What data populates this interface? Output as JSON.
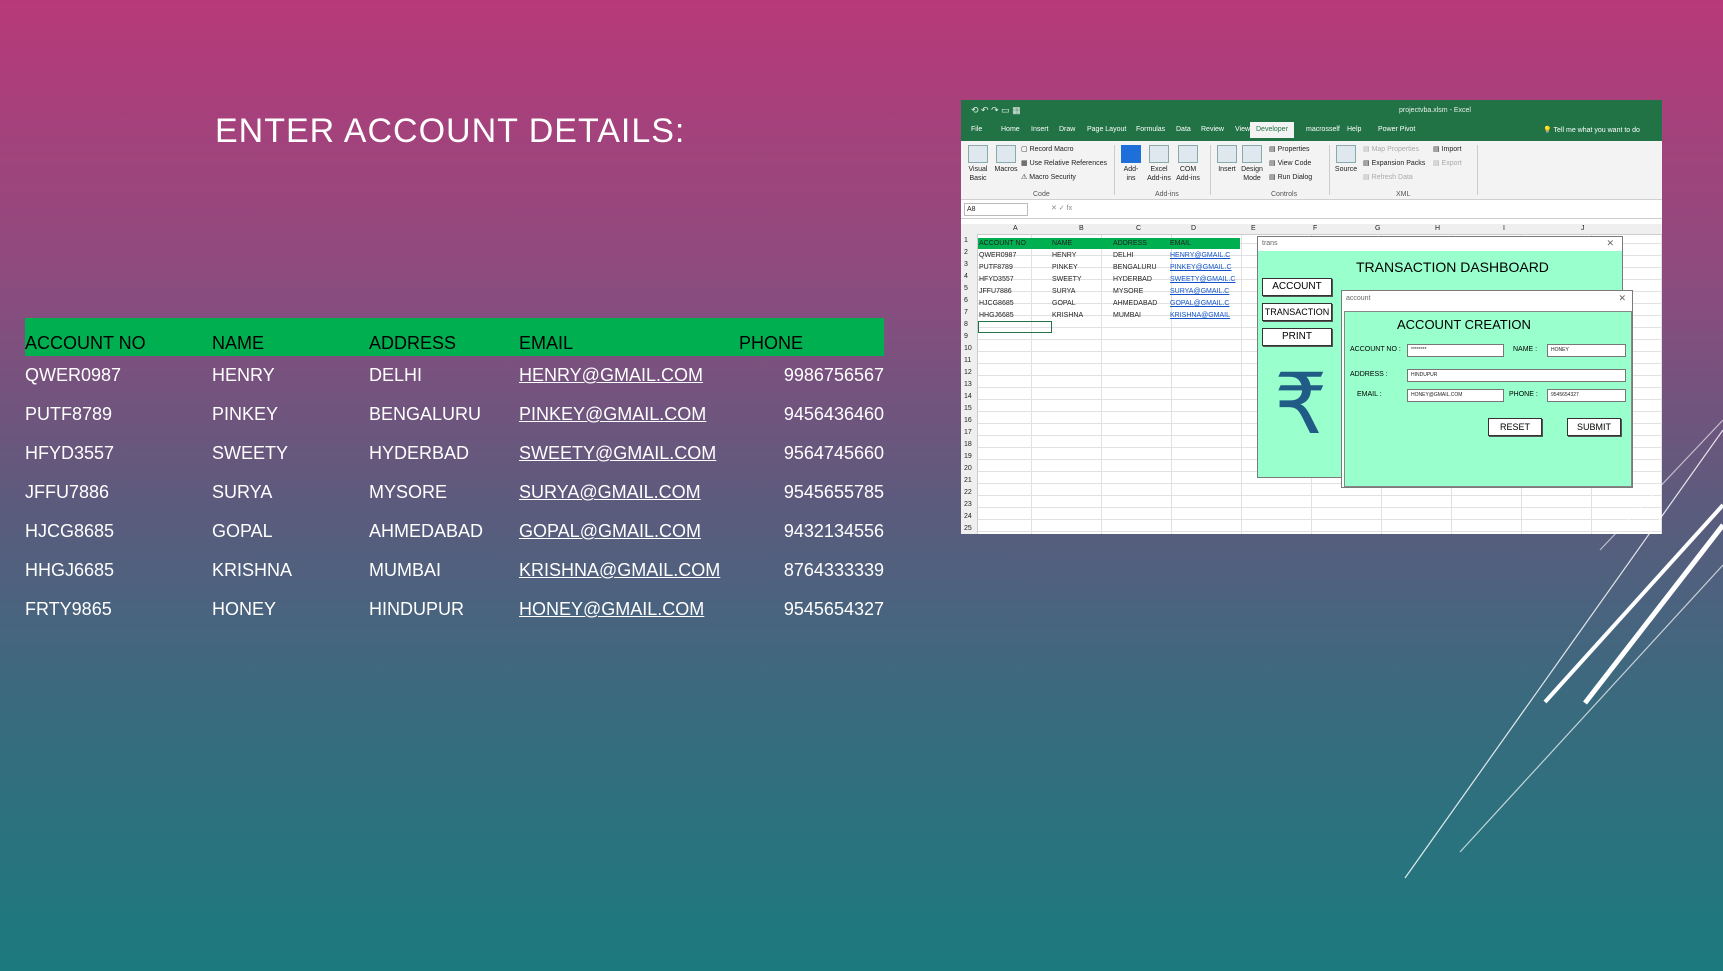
{
  "slide": {
    "title": "ENTER ACCOUNT DETAILS:"
  },
  "table": {
    "headers": [
      "ACCOUNT NO",
      "NAME",
      "ADDRESS",
      "EMAIL",
      "PHONE"
    ],
    "rows": [
      [
        "QWER0987",
        "HENRY",
        "DELHI",
        "HENRY@GMAIL.COM",
        "9986756567"
      ],
      [
        "PUTF8789",
        "PINKEY",
        "BENGALURU",
        "PINKEY@GMAIL.COM",
        "9456436460"
      ],
      [
        "HFYD3557",
        "SWEETY",
        "HYDERBAD",
        "SWEETY@GMAIL.COM",
        "9564745660"
      ],
      [
        "JFFU7886",
        "SURYA",
        "MYSORE",
        "SURYA@GMAIL.COM",
        "9545655785"
      ],
      [
        "HJCG8685",
        "GOPAL",
        "AHMEDABAD",
        "GOPAL@GMAIL.COM",
        "9432134556"
      ],
      [
        "HHGJ6685",
        "KRISHNA",
        "MUMBAI",
        "KRISHNA@GMAIL.COM",
        "8764333339"
      ],
      [
        "FRTY9865",
        "HONEY",
        "HINDUPUR",
        "HONEY@GMAIL.COM",
        "9545654327"
      ]
    ]
  },
  "excel": {
    "filename": "projectvba.xlsm  -  Excel",
    "tabs": [
      "File",
      "Home",
      "Insert",
      "Draw",
      "Page Layout",
      "Formulas",
      "Data",
      "Review",
      "View",
      "Developer",
      "macrosself",
      "Help",
      "Power Pivot"
    ],
    "active_tab": "Developer",
    "tell_me": "Tell me what you want to do",
    "ribbon": {
      "visual_basic": "Visual Basic",
      "macros": "Macros",
      "record_macro": "Record Macro",
      "use_relative": "Use Relative References",
      "macro_security": "Macro Security",
      "code_group": "Code",
      "addins": "Add-ins",
      "excel_addins": "Excel Add-ins",
      "com_addins": "COM Add-ins",
      "addins_group": "Add-ins",
      "insert": "Insert",
      "design_mode": "Design Mode",
      "properties": "Properties",
      "view_code": "View Code",
      "run_dialog": "Run Dialog",
      "controls_group": "Controls",
      "source": "Source",
      "map_properties": "Map Properties",
      "expansion_packs": "Expansion Packs",
      "refresh_data": "Refresh Data",
      "import": "Import",
      "export": "Export",
      "xml_group": "XML"
    },
    "name_box": "A8",
    "columns": [
      "A",
      "B",
      "C",
      "D",
      "E",
      "F",
      "G",
      "H",
      "I",
      "J"
    ],
    "row_numbers": [
      "1",
      "2",
      "3",
      "4",
      "5",
      "6",
      "7",
      "8",
      "9",
      "10",
      "11",
      "12",
      "13",
      "14",
      "15",
      "16",
      "17",
      "18",
      "19",
      "20",
      "21",
      "22",
      "23",
      "24",
      "25"
    ],
    "sheet_header": [
      "ACCOUNT NO",
      "NAME",
      "ADDRESS",
      "EMAIL"
    ],
    "sheet_rows": [
      [
        "QWER0987",
        "HENRY",
        "DELHI",
        "HENRY@GMAIL.C"
      ],
      [
        "PUTF8789",
        "PINKEY",
        "BENGALURU",
        "PINKEY@GMAIL.C"
      ],
      [
        "HFYD3557",
        "SWEETY",
        "HYDERBAD",
        "SWEETY@GMAIL.C"
      ],
      [
        "JFFU7886",
        "SURYA",
        "MYSORE",
        "SURYA@GMAIL.C"
      ],
      [
        "HJCG8685",
        "GOPAL",
        "AHMEDABAD",
        "GOPAL@GMAIL.C"
      ],
      [
        "HHGJ6685",
        "KRISHNA",
        "MUMBAI",
        "KRISHNA@GMAIL"
      ]
    ]
  },
  "dashboard": {
    "window_title": "trans",
    "heading": "TRANSACTION DASHBOARD",
    "account_btn": "ACCOUNT",
    "transaction_btn": "TRANSACTION",
    "print_btn": "PRINT",
    "rupee_symbol": "₹"
  },
  "account_form": {
    "window_title": "account",
    "heading": "ACCOUNT CREATION",
    "account_no_label": "ACCOUNT NO :",
    "account_no_value": "********",
    "name_label": "NAME :",
    "name_value": "HONEY",
    "address_label": "ADDRESS :",
    "address_value": "HINDUPUR",
    "email_label": "EMAIL :",
    "email_value": "HONEY@GMAIL.COM",
    "phone_label": "PHONE :",
    "phone_value": "9545654327",
    "reset_btn": "RESET",
    "submit_btn": "SUBMIT"
  }
}
